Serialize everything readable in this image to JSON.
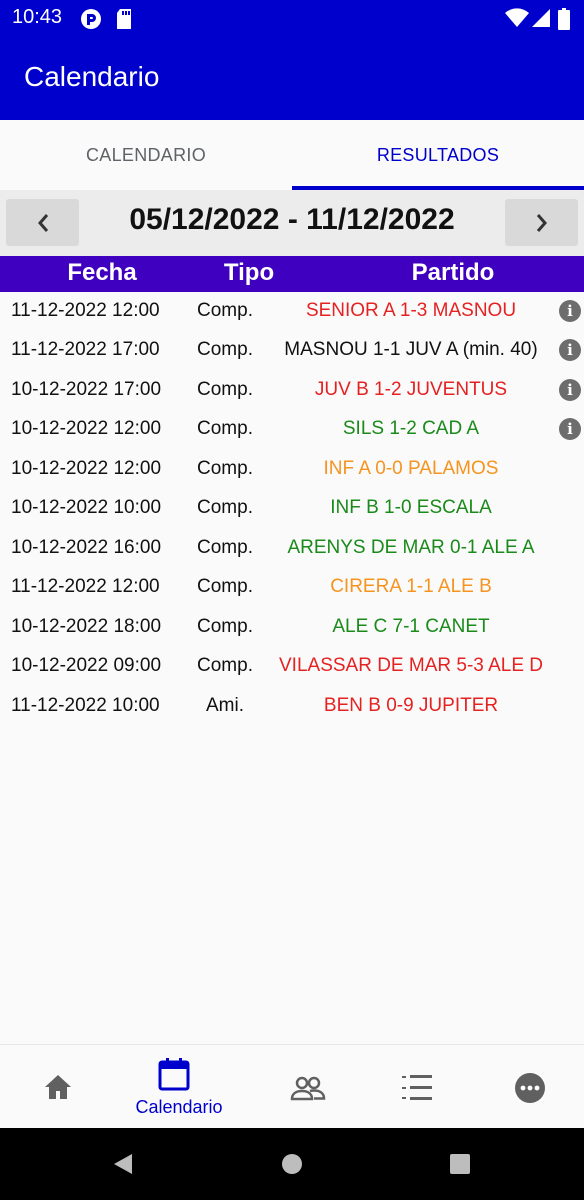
{
  "status_bar": {
    "time": "10:43"
  },
  "app_bar": {
    "title": "Calendario"
  },
  "tabs": [
    {
      "label": "CALENDARIO",
      "selected": false
    },
    {
      "label": "RESULTADOS",
      "selected": true
    }
  ],
  "week_selector": {
    "label": "05/12/2022 - 11/12/2022"
  },
  "table": {
    "headers": {
      "fecha": "Fecha",
      "tipo": "Tipo",
      "partido": "Partido"
    },
    "rows": [
      {
        "fecha": "11-12-2022 12:00",
        "tipo": "Comp.",
        "partido": "SENIOR A 1-3 MASNOU",
        "color": "#e52222",
        "info": true
      },
      {
        "fecha": "11-12-2022 17:00",
        "tipo": "Comp.",
        "partido": "MASNOU 1-1 JUV A (min. 40)",
        "color": "#111111",
        "info": true
      },
      {
        "fecha": "10-12-2022 17:00",
        "tipo": "Comp.",
        "partido": "JUV B 1-2 JUVENTUS",
        "color": "#e52222",
        "info": true
      },
      {
        "fecha": "10-12-2022 12:00",
        "tipo": "Comp.",
        "partido": "SILS 1-2 CAD A",
        "color": "#1a8a1a",
        "info": true
      },
      {
        "fecha": "10-12-2022 12:00",
        "tipo": "Comp.",
        "partido": "INF A 0-0 PALAMOS",
        "color": "#f5941f",
        "info": false
      },
      {
        "fecha": "10-12-2022 10:00",
        "tipo": "Comp.",
        "partido": "INF B 1-0 ESCALA",
        "color": "#1a8a1a",
        "info": false
      },
      {
        "fecha": "10-12-2022 16:00",
        "tipo": "Comp.",
        "partido": "ARENYS DE MAR 0-1 ALE A",
        "color": "#1a8a1a",
        "info": false
      },
      {
        "fecha": "11-12-2022 12:00",
        "tipo": "Comp.",
        "partido": "CIRERA 1-1 ALE B",
        "color": "#f5941f",
        "info": false
      },
      {
        "fecha": "10-12-2022 18:00",
        "tipo": "Comp.",
        "partido": "ALE C 7-1 CANET",
        "color": "#1a8a1a",
        "info": false
      },
      {
        "fecha": "10-12-2022 09:00",
        "tipo": "Comp.",
        "partido": "VILASSAR DE MAR 5-3 ALE D",
        "color": "#e52222",
        "info": false
      },
      {
        "fecha": "11-12-2022 10:00",
        "tipo": "Ami.",
        "partido": "BEN B 0-9 JUPITER",
        "color": "#e52222",
        "info": false
      }
    ],
    "info_glyph": "i"
  },
  "bottom_nav": {
    "items": [
      {
        "icon": "home-icon",
        "label": "",
        "selected": false
      },
      {
        "icon": "calendar-icon",
        "label": "Calendario",
        "selected": true
      },
      {
        "icon": "people-icon",
        "label": "",
        "selected": false
      },
      {
        "icon": "ranking-list-icon",
        "label": "",
        "selected": false
      },
      {
        "icon": "more-icon",
        "label": "",
        "selected": false
      }
    ]
  },
  "colors": {
    "primary": "#0000cc",
    "table_header": "#4000bf",
    "win": "#1a8a1a",
    "draw": "#f5941f",
    "loss": "#e52222"
  }
}
